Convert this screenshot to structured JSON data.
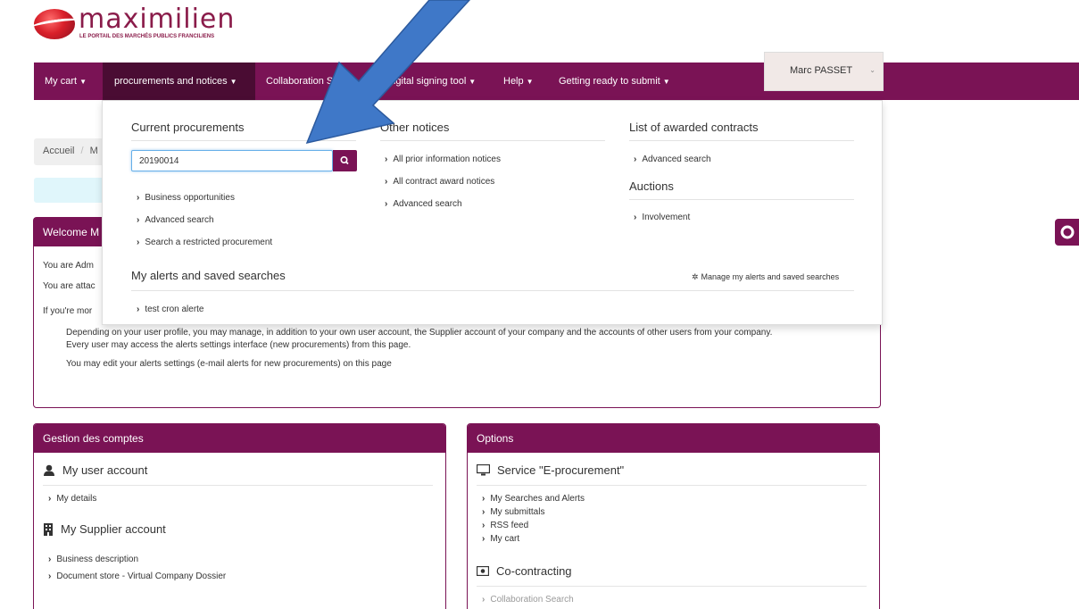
{
  "logo": {
    "name": "maximilien",
    "tagline": "LE PORTAIL DES MARCHÉS PUBLICS FRANCILIENS"
  },
  "nav": {
    "items": [
      {
        "label": "My cart"
      },
      {
        "label": "procurements and notices"
      },
      {
        "label": "Collaboration Search"
      },
      {
        "label": "Digital signing tool"
      },
      {
        "label": "Help"
      },
      {
        "label": "Getting ready to submit"
      }
    ],
    "user": "Marc PASSET"
  },
  "breadcrumb": {
    "home": "Accueil",
    "current": "M"
  },
  "welcome": {
    "title": "Welcome M",
    "line1": "You are Adm",
    "line2": "You are attac",
    "line3": "If you're mor",
    "desc1": "Depending on your user profile, you may manage, in addition to your own user account, the Supplier account of your company and the accounts of other users from your company.",
    "desc2": "Every user may access the alerts settings interface (new procurements) from this page.",
    "desc3": "You may edit your alerts settings (e-mail alerts for new procurements) on this page"
  },
  "mega": {
    "current": {
      "title": "Current procurements",
      "search_value": "20190014",
      "links": [
        "Business opportunities",
        "Advanced search",
        "Search a restricted procurement"
      ]
    },
    "other": {
      "title": "Other notices",
      "links": [
        "All prior information notices",
        "All contract award notices",
        "Advanced search"
      ]
    },
    "awarded": {
      "title": "List of awarded contracts",
      "links": [
        "Advanced search"
      ]
    },
    "auctions": {
      "title": "Auctions",
      "links": [
        "Involvement"
      ]
    },
    "alerts": {
      "title": "My alerts and saved searches",
      "manage": "Manage my alerts and saved searches",
      "links": [
        "test cron alerte"
      ]
    }
  },
  "accounts": {
    "title": "Gestion des comptes",
    "user_account": "My user account",
    "user_links": [
      "My details"
    ],
    "supplier_account": "My Supplier account",
    "supplier_links": [
      "Business description",
      "Document store - Virtual Company Dossier"
    ]
  },
  "options": {
    "title": "Options",
    "eproc": "Service \"E-procurement\"",
    "eproc_links": [
      "My Searches and Alerts",
      "My submittals",
      "RSS feed",
      "My cart"
    ],
    "cocontracting": "Co-contracting",
    "cocontracting_links": [
      "Collaboration Search"
    ]
  },
  "colors": {
    "brand": "#7a1355",
    "arrow": "#3f78c8"
  }
}
